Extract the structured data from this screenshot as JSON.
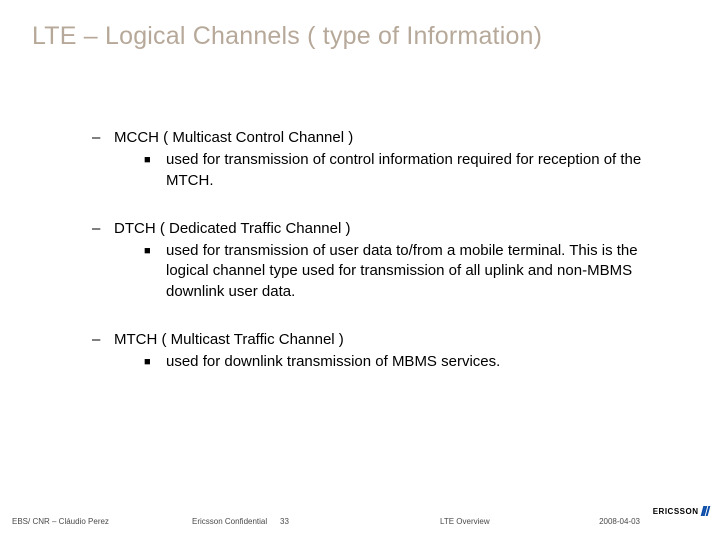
{
  "title": "LTE – Logical Channels ( type of Information)",
  "items": [
    {
      "heading": "MCCH ( Multicast Control Channel )",
      "desc": "used for transmission of control information required for reception of the MTCH."
    },
    {
      "heading": "DTCH ( Dedicated Traffic Channel )",
      "desc": "used for transmission of user data to/from a mobile terminal. This is the logical channel type used for transmission of all uplink and non-MBMS downlink user data."
    },
    {
      "heading": "MTCH ( Multicast Traffic Channel )",
      "desc": "used for downlink transmission of MBMS services."
    }
  ],
  "footer": {
    "author": "EBS/ CNR – Cláudio Perez",
    "confidential": "Ericsson Confidential",
    "page": "33",
    "topic": "LTE  Overview",
    "date": "2008-04-03",
    "logo": "ERICSSON"
  }
}
